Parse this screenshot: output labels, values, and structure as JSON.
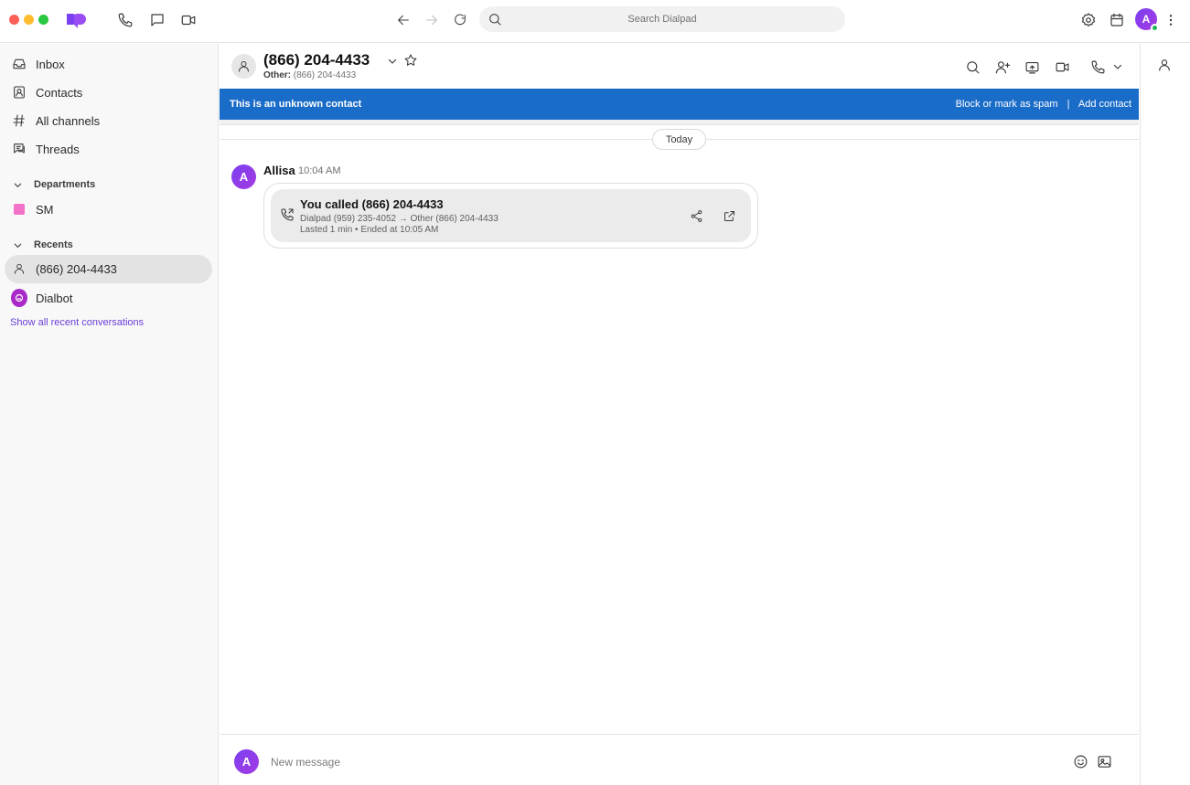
{
  "search": {
    "placeholder": "Search Dialpad"
  },
  "user": {
    "initial": "A"
  },
  "sidebar": {
    "nav": [
      {
        "label": "Inbox",
        "icon": "inbox-icon"
      },
      {
        "label": "Contacts",
        "icon": "contacts-icon"
      },
      {
        "label": "All channels",
        "icon": "hash-icon"
      },
      {
        "label": "Threads",
        "icon": "threads-icon"
      }
    ],
    "departments_title": "Departments",
    "departments": [
      {
        "label": "SM",
        "color": "#f271c9"
      }
    ],
    "recents_title": "Recents",
    "recents": [
      {
        "label": "(866) 204-4433",
        "active": true
      },
      {
        "label": "Dialbot",
        "active": false
      }
    ],
    "show_all": "Show all recent conversations"
  },
  "conversation": {
    "name": "(866) 204-4433",
    "sub_label": "Other:",
    "sub_value": "(866) 204-4433",
    "banner_text": "This is an unknown contact",
    "banner_block": "Block or mark as spam",
    "banner_sep": "|",
    "banner_add": "Add contact",
    "date": "Today",
    "message": {
      "author": "Allisa",
      "author_initial": "A",
      "time": "10:04 AM",
      "call_title": "You called (866) 204-4433",
      "call_route": "Dialpad (959) 235-4052 → Other (866) 204-4433",
      "call_detail": "Lasted 1 min • Ended at 10:05 AM"
    },
    "composer_placeholder": "New message"
  },
  "colors": {
    "banner": "#1a6cc9",
    "accent": "#7b3ff2",
    "online": "#1eb35a"
  }
}
